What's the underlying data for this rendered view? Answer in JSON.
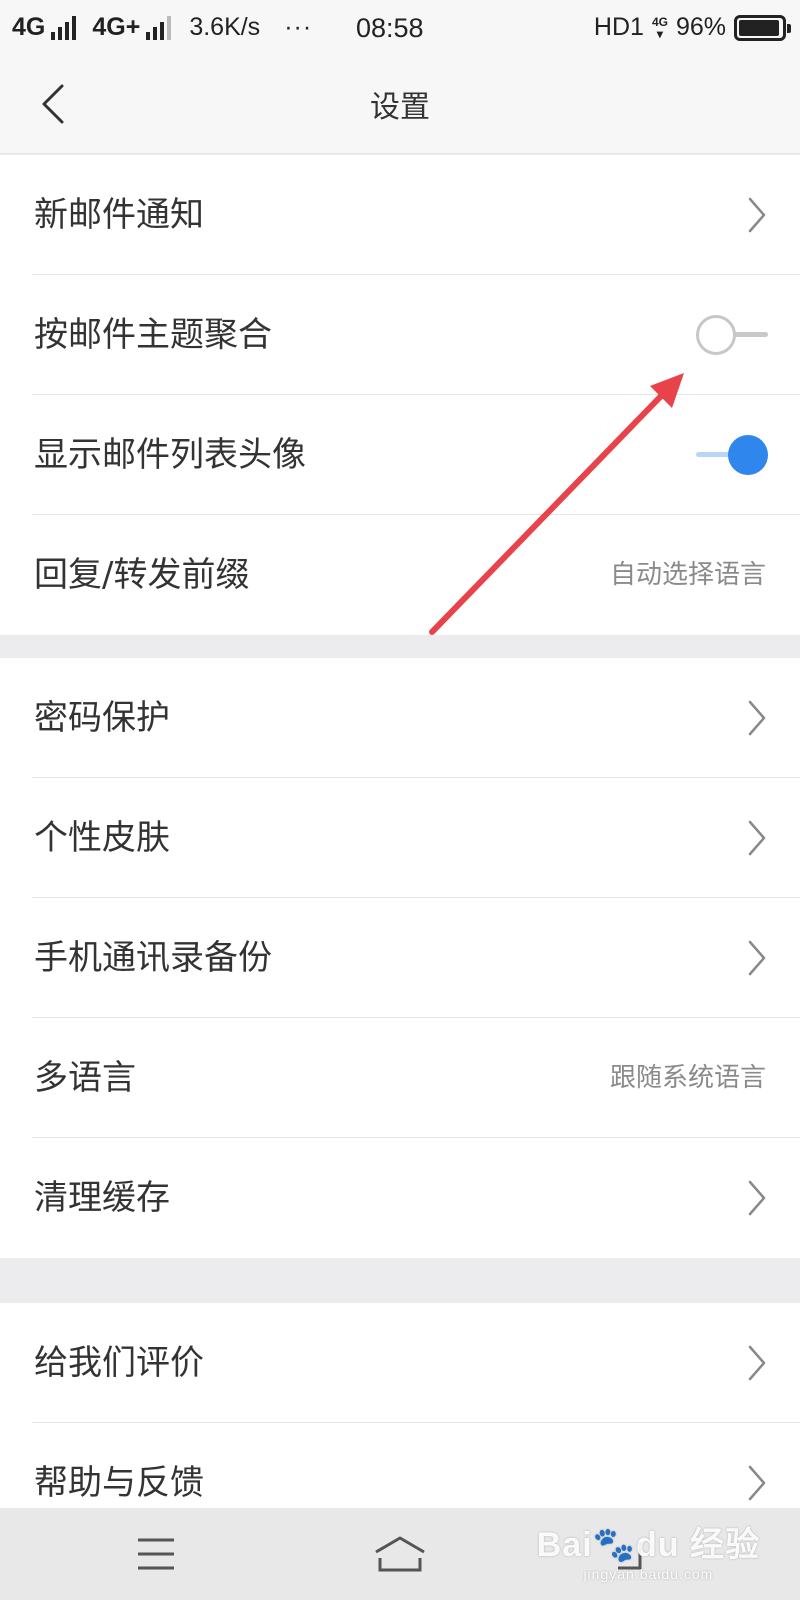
{
  "status_bar": {
    "network1": "4G",
    "network2": "4G+",
    "speed": "3.6K/s",
    "dots": "···",
    "time": "08:58",
    "hd": "HD1",
    "net_small": "4G",
    "battery_text": "96%",
    "battery_level": 0.96
  },
  "header": {
    "title": "设置",
    "back_icon": "chevron-left-icon"
  },
  "group1": [
    {
      "label": "新邮件通知",
      "control": "chevron"
    },
    {
      "label": "按邮件主题聚合",
      "control": "toggle",
      "on": false
    },
    {
      "label": "显示邮件列表头像",
      "control": "toggle",
      "on": true
    },
    {
      "label": "回复/转发前缀",
      "control": "value",
      "value": "自动选择语言"
    }
  ],
  "group2": [
    {
      "label": "密码保护",
      "control": "chevron"
    },
    {
      "label": "个性皮肤",
      "control": "chevron"
    },
    {
      "label": "手机通讯录备份",
      "control": "chevron"
    },
    {
      "label": "多语言",
      "control": "value",
      "value": "跟随系统语言"
    },
    {
      "label": "清理缓存",
      "control": "chevron"
    }
  ],
  "group3": [
    {
      "label": "给我们评价",
      "control": "chevron"
    },
    {
      "label": "帮助与反馈",
      "control": "chevron"
    }
  ],
  "colors": {
    "accent": "#2f86ec",
    "annotation_arrow": "#e8424a",
    "background": "#ececee"
  },
  "watermark": {
    "main": "Bai du 经验",
    "sub": "jingyan.baidu.com"
  }
}
